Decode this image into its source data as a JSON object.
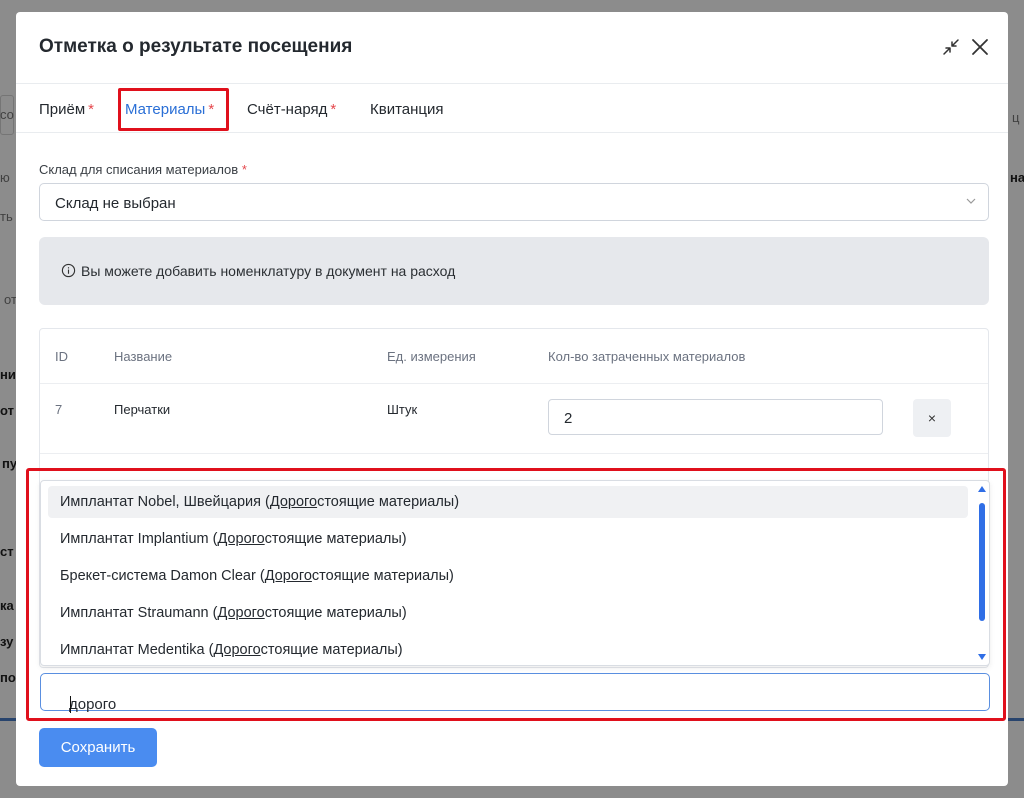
{
  "background": {
    "fragments": [
      "со",
      "ю",
      "ть",
      "от",
      "ни",
      "от",
      "пу",
      "ст",
      "ка",
      "зу",
      "по",
      "ц",
      "на"
    ]
  },
  "modal": {
    "title": "Отметка о результате посещения",
    "tabs": [
      {
        "label": "Приём",
        "required": "*"
      },
      {
        "label": "Материалы",
        "required": "*"
      },
      {
        "label": "Счёт-наряд",
        "required": "*"
      },
      {
        "label": "Квитанция",
        "required": ""
      }
    ],
    "active_tab": "Материалы"
  },
  "warehouse": {
    "label": "Склад для списания материалов",
    "required": "*",
    "value": "Склад не выбран"
  },
  "info": {
    "text": "Вы можете добавить номенклатуру в документ на расход"
  },
  "table": {
    "headers": [
      "ID",
      "Название",
      "Ед. измерения",
      "Кол-во затраченных материалов"
    ],
    "rows": [
      {
        "id": "7",
        "name": "Перчатки",
        "unit": "Штук",
        "qty": "2",
        "delete": "×"
      }
    ]
  },
  "dropdown": {
    "options": [
      {
        "prefix": "Имплантат Nobel, Швейцария (",
        "match": "Дорого",
        "suffix": "стоящие материалы)"
      },
      {
        "prefix": "Имплантат Implantium (",
        "match": "Дорого",
        "suffix": "стоящие материалы)"
      },
      {
        "prefix": "Брекет-система Damon Clear (",
        "match": "Дорого",
        "suffix": "стоящие материалы)"
      },
      {
        "prefix": "Имплантат Straumann (",
        "match": "Дорого",
        "suffix": "стоящие материалы)"
      },
      {
        "prefix": "Имплантат Medentika (",
        "match": "Дорого",
        "suffix": "стоящие материалы)"
      }
    ],
    "search_value": "дорого"
  },
  "save_label": "Сохранить",
  "colors": {
    "accent": "#2a6fd6",
    "highlight": "#e0101c",
    "button": "#4a8cf0"
  }
}
